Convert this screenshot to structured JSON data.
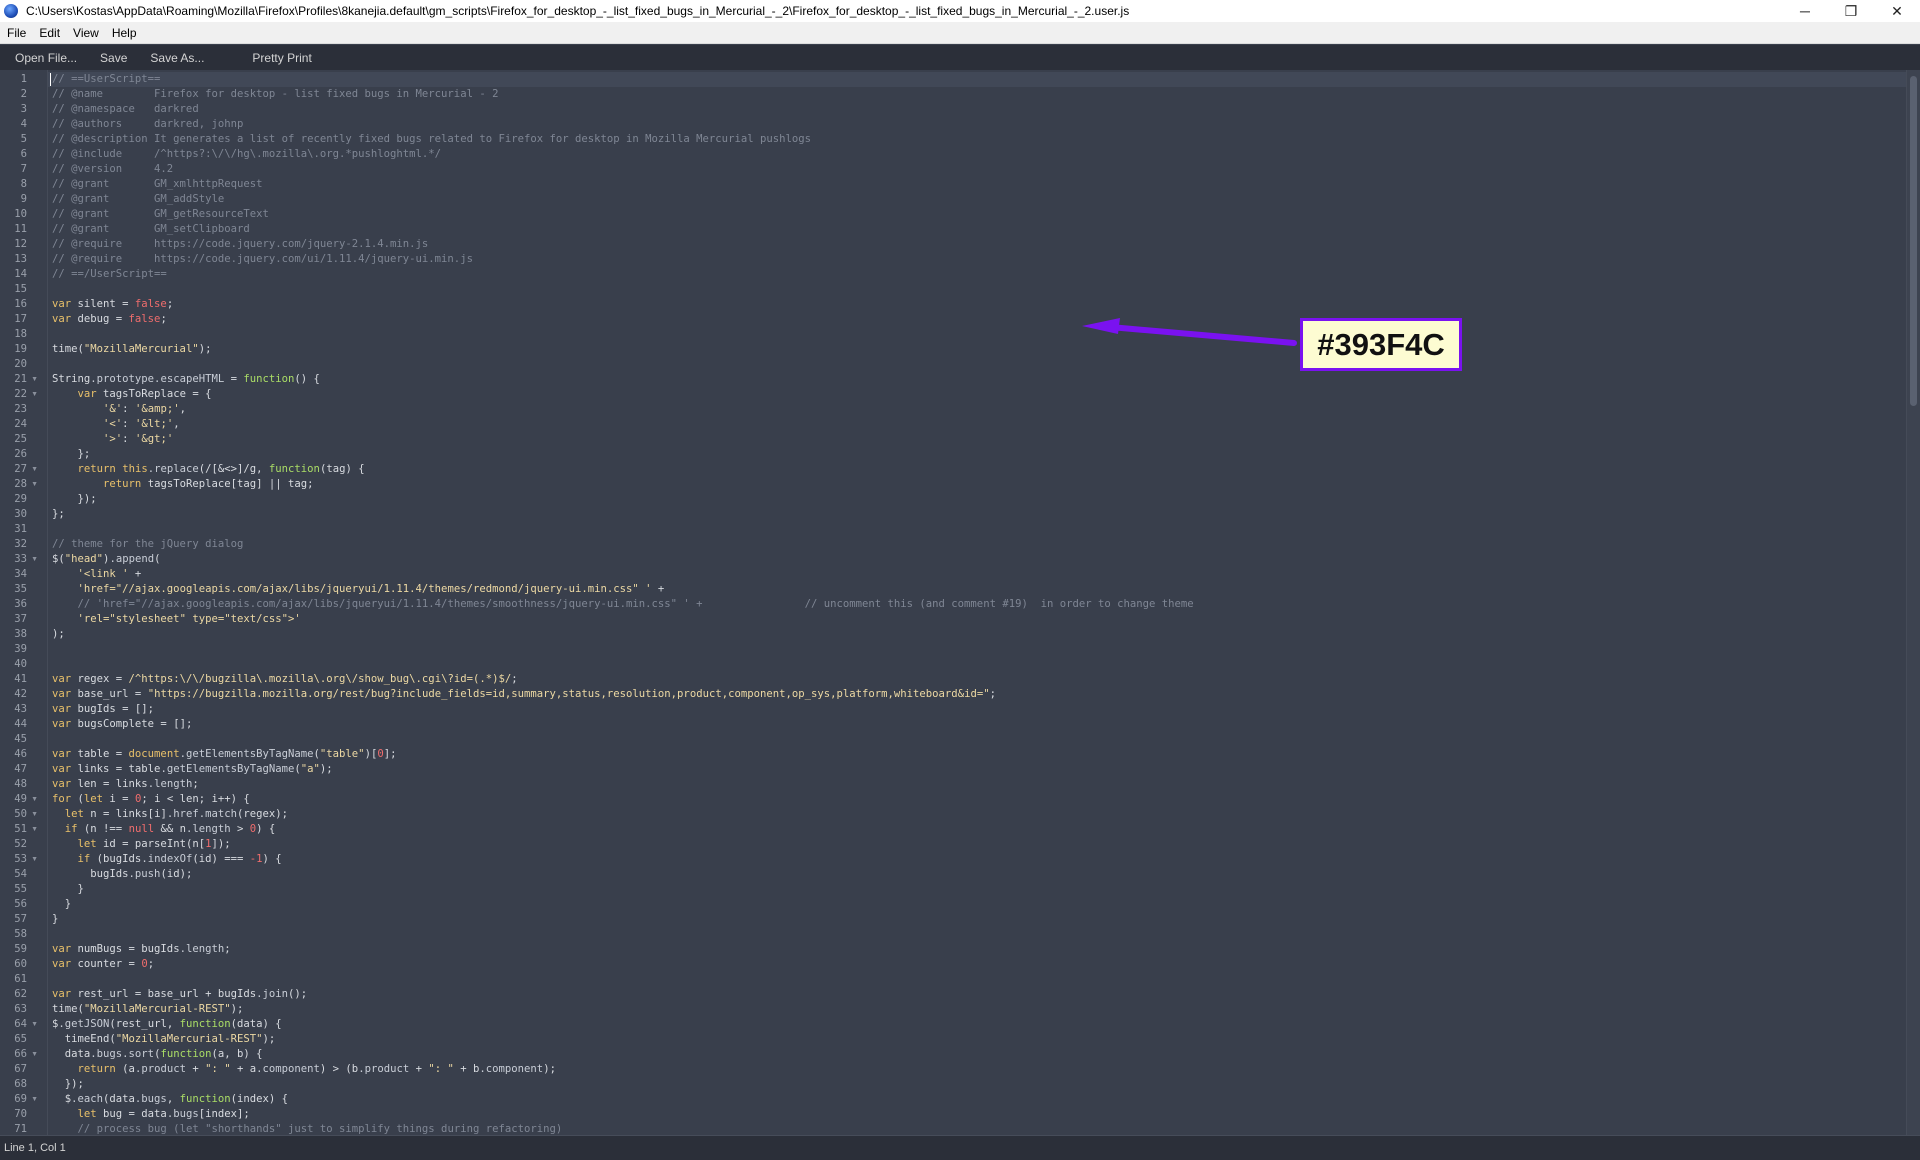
{
  "window": {
    "title": "C:\\Users\\Kostas\\AppData\\Roaming\\Mozilla\\Firefox\\Profiles\\8kanejia.default\\gm_scripts\\Firefox_for_desktop_-_list_fixed_bugs_in_Mercurial_-_2\\Firefox_for_desktop_-_list_fixed_bugs_in_Mercurial_-_2.user.js",
    "app_icon": "firefox-globe-icon",
    "minimize_glyph": "─",
    "maximize_glyph": "❐",
    "close_glyph": "✕"
  },
  "menubar": {
    "items": [
      "File",
      "Edit",
      "View",
      "Help"
    ]
  },
  "toolbar": {
    "open_file": "Open File...",
    "save": "Save",
    "save_as": "Save As...",
    "pretty_print": "Pretty Print"
  },
  "editor": {
    "background_color": "#393F4C",
    "current_line": 1,
    "fold_markers": [
      21,
      22,
      27,
      28,
      33,
      49,
      50,
      51,
      53,
      64,
      66,
      69
    ],
    "lines": [
      [
        [
          "com",
          "// ==UserScript=="
        ]
      ],
      [
        [
          "com",
          "// @name        Firefox for desktop - list fixed bugs in Mercurial - 2"
        ]
      ],
      [
        [
          "com",
          "// @namespace   darkred"
        ]
      ],
      [
        [
          "com",
          "// @authors     darkred, johnp"
        ]
      ],
      [
        [
          "com",
          "// @description It generates a list of recently fixed bugs related to Firefox for desktop in Mozilla Mercurial pushlogs"
        ]
      ],
      [
        [
          "com",
          "// @include     /^https?:\\/\\/hg\\.mozilla\\.org.*pushloghtml.*/"
        ]
      ],
      [
        [
          "com",
          "// @version     4.2"
        ]
      ],
      [
        [
          "com",
          "// @grant       GM_xmlhttpRequest"
        ]
      ],
      [
        [
          "com",
          "// @grant       GM_addStyle"
        ]
      ],
      [
        [
          "com",
          "// @grant       GM_getResourceText"
        ]
      ],
      [
        [
          "com",
          "// @grant       GM_setClipboard"
        ]
      ],
      [
        [
          "com",
          "// @require     https://code.jquery.com/jquery-2.1.4.min.js"
        ]
      ],
      [
        [
          "com",
          "// @require     https://code.jquery.com/ui/1.11.4/jquery-ui.min.js"
        ]
      ],
      [
        [
          "com",
          "// ==/UserScript=="
        ]
      ],
      [],
      [
        [
          "kw",
          "var"
        ],
        [
          "plain",
          " silent = "
        ],
        [
          "bool",
          "false"
        ],
        [
          "plain",
          ";"
        ]
      ],
      [
        [
          "kw",
          "var"
        ],
        [
          "plain",
          " debug = "
        ],
        [
          "bool",
          "false"
        ],
        [
          "plain",
          ";"
        ]
      ],
      [],
      [
        [
          "plain",
          "time("
        ],
        [
          "str",
          "\"MozillaMercurial\""
        ],
        [
          "plain",
          ");"
        ]
      ],
      [],
      [
        [
          "plain",
          "String"
        ],
        [
          "prop",
          ".prototype.escapeHTML"
        ],
        [
          "plain",
          " = "
        ],
        [
          "fn",
          "function"
        ],
        [
          "plain",
          "() {"
        ]
      ],
      [
        [
          "plain",
          "    "
        ],
        [
          "kw",
          "var"
        ],
        [
          "plain",
          " tagsToReplace = {"
        ]
      ],
      [
        [
          "plain",
          "        "
        ],
        [
          "str",
          "'&'"
        ],
        [
          "plain",
          ": "
        ],
        [
          "str",
          "'&amp;'"
        ],
        [
          "plain",
          ","
        ]
      ],
      [
        [
          "plain",
          "        "
        ],
        [
          "str",
          "'<'"
        ],
        [
          "plain",
          ": "
        ],
        [
          "str",
          "'&lt;'"
        ],
        [
          "plain",
          ","
        ]
      ],
      [
        [
          "plain",
          "        "
        ],
        [
          "str",
          "'>'"
        ],
        [
          "plain",
          ": "
        ],
        [
          "str",
          "'&gt;'"
        ]
      ],
      [
        [
          "plain",
          "    };"
        ]
      ],
      [
        [
          "plain",
          "    "
        ],
        [
          "kw",
          "return"
        ],
        [
          "plain",
          " "
        ],
        [
          "kw",
          "this"
        ],
        [
          "prop",
          ".replace"
        ],
        [
          "plain",
          "(/[&<>]/g, "
        ],
        [
          "fn",
          "function"
        ],
        [
          "plain",
          "(tag) {"
        ]
      ],
      [
        [
          "plain",
          "        "
        ],
        [
          "kw",
          "return"
        ],
        [
          "plain",
          " tagsToReplace[tag] || tag;"
        ]
      ],
      [
        [
          "plain",
          "    });"
        ]
      ],
      [
        [
          "plain",
          "};"
        ]
      ],
      [],
      [
        [
          "com",
          "// theme for the jQuery dialog"
        ]
      ],
      [
        [
          "plain",
          "$("
        ],
        [
          "str",
          "\"head\""
        ],
        [
          "plain",
          ")"
        ],
        [
          "prop",
          ".append"
        ],
        [
          "plain",
          "("
        ]
      ],
      [
        [
          "plain",
          "    "
        ],
        [
          "str",
          "'<link '"
        ],
        [
          "plain",
          " +"
        ]
      ],
      [
        [
          "plain",
          "    "
        ],
        [
          "str",
          "'href=\"//ajax.googleapis.com/ajax/libs/jqueryui/1.11.4/themes/redmond/jquery-ui.min.css\" '"
        ],
        [
          "plain",
          " +"
        ]
      ],
      [
        [
          "plain",
          "    "
        ],
        [
          "com",
          "// 'href=\"//ajax.googleapis.com/ajax/libs/jqueryui/1.11.4/themes/smoothness/jquery-ui.min.css\" ' +                // uncomment this (and comment #19)  in order to change theme"
        ]
      ],
      [
        [
          "plain",
          "    "
        ],
        [
          "str",
          "'rel=\"stylesheet\" type=\"text/css\">'"
        ]
      ],
      [
        [
          "plain",
          ");"
        ]
      ],
      [],
      [],
      [
        [
          "kw",
          "var"
        ],
        [
          "plain",
          " regex = "
        ],
        [
          "str",
          "/^https:\\/\\/bugzilla\\.mozilla\\.org\\/show_bug\\.cgi\\?id=(.*)$/"
        ],
        [
          "plain",
          ";"
        ]
      ],
      [
        [
          "kw",
          "var"
        ],
        [
          "plain",
          " base_url = "
        ],
        [
          "str",
          "\"https://bugzilla.mozilla.org/rest/bug?include_fields=id,summary,status,resolution,product,component,op_sys,platform,whiteboard&id=\""
        ],
        [
          "plain",
          ";"
        ]
      ],
      [
        [
          "kw",
          "var"
        ],
        [
          "plain",
          " bugIds = [];"
        ]
      ],
      [
        [
          "kw",
          "var"
        ],
        [
          "plain",
          " bugsComplete = [];"
        ]
      ],
      [],
      [
        [
          "kw",
          "var"
        ],
        [
          "plain",
          " table = "
        ],
        [
          "kw",
          "document"
        ],
        [
          "prop",
          ".getElementsByTagName"
        ],
        [
          "plain",
          "("
        ],
        [
          "str",
          "\"table\""
        ],
        [
          "plain",
          ")["
        ],
        [
          "num",
          "0"
        ],
        [
          "plain",
          "];"
        ]
      ],
      [
        [
          "kw",
          "var"
        ],
        [
          "plain",
          " links = table"
        ],
        [
          "prop",
          ".getElementsByTagName"
        ],
        [
          "plain",
          "("
        ],
        [
          "str",
          "\"a\""
        ],
        [
          "plain",
          ");"
        ]
      ],
      [
        [
          "kw",
          "var"
        ],
        [
          "plain",
          " len = links"
        ],
        [
          "prop",
          ".length"
        ],
        [
          "plain",
          ";"
        ]
      ],
      [
        [
          "kw",
          "for"
        ],
        [
          "plain",
          " ("
        ],
        [
          "kw",
          "let"
        ],
        [
          "plain",
          " i = "
        ],
        [
          "num",
          "0"
        ],
        [
          "plain",
          "; i < len; i++) {"
        ]
      ],
      [
        [
          "plain",
          "  "
        ],
        [
          "kw",
          "let"
        ],
        [
          "plain",
          " n = links[i]"
        ],
        [
          "prop",
          ".href.match"
        ],
        [
          "plain",
          "(regex);"
        ]
      ],
      [
        [
          "plain",
          "  "
        ],
        [
          "kw",
          "if"
        ],
        [
          "plain",
          " (n !== "
        ],
        [
          "bool",
          "null"
        ],
        [
          "plain",
          " && n"
        ],
        [
          "prop",
          ".length"
        ],
        [
          "plain",
          " > "
        ],
        [
          "num",
          "0"
        ],
        [
          "plain",
          ") {"
        ]
      ],
      [
        [
          "plain",
          "    "
        ],
        [
          "kw",
          "let"
        ],
        [
          "plain",
          " id = parseInt(n["
        ],
        [
          "num",
          "1"
        ],
        [
          "plain",
          "]);"
        ]
      ],
      [
        [
          "plain",
          "    "
        ],
        [
          "kw",
          "if"
        ],
        [
          "plain",
          " (bugIds"
        ],
        [
          "prop",
          ".indexOf"
        ],
        [
          "plain",
          "(id) === "
        ],
        [
          "num",
          "-1"
        ],
        [
          "plain",
          ") {"
        ]
      ],
      [
        [
          "plain",
          "      bugIds"
        ],
        [
          "prop",
          ".push"
        ],
        [
          "plain",
          "(id);"
        ]
      ],
      [
        [
          "plain",
          "    }"
        ]
      ],
      [
        [
          "plain",
          "  }"
        ]
      ],
      [
        [
          "plain",
          "}"
        ]
      ],
      [],
      [
        [
          "kw",
          "var"
        ],
        [
          "plain",
          " numBugs = bugIds"
        ],
        [
          "prop",
          ".length"
        ],
        [
          "plain",
          ";"
        ]
      ],
      [
        [
          "kw",
          "var"
        ],
        [
          "plain",
          " counter = "
        ],
        [
          "num",
          "0"
        ],
        [
          "plain",
          ";"
        ]
      ],
      [],
      [
        [
          "kw",
          "var"
        ],
        [
          "plain",
          " rest_url = base_url + bugIds"
        ],
        [
          "prop",
          ".join"
        ],
        [
          "plain",
          "();"
        ]
      ],
      [
        [
          "plain",
          "time("
        ],
        [
          "str",
          "\"MozillaMercurial-REST\""
        ],
        [
          "plain",
          ");"
        ]
      ],
      [
        [
          "plain",
          "$"
        ],
        [
          "prop",
          ".getJSON"
        ],
        [
          "plain",
          "(rest_url, "
        ],
        [
          "fn",
          "function"
        ],
        [
          "plain",
          "(data) {"
        ]
      ],
      [
        [
          "plain",
          "  timeEnd("
        ],
        [
          "str",
          "\"MozillaMercurial-REST\""
        ],
        [
          "plain",
          ");"
        ]
      ],
      [
        [
          "plain",
          "  data"
        ],
        [
          "prop",
          ".bugs.sort"
        ],
        [
          "plain",
          "("
        ],
        [
          "fn",
          "function"
        ],
        [
          "plain",
          "(a, b) {"
        ]
      ],
      [
        [
          "plain",
          "    "
        ],
        [
          "kw",
          "return"
        ],
        [
          "plain",
          " (a"
        ],
        [
          "prop",
          ".product"
        ],
        [
          "plain",
          " + "
        ],
        [
          "str",
          "\": \""
        ],
        [
          "plain",
          " + a"
        ],
        [
          "prop",
          ".component"
        ],
        [
          "plain",
          ") > (b"
        ],
        [
          "prop",
          ".product"
        ],
        [
          "plain",
          " + "
        ],
        [
          "str",
          "\": \""
        ],
        [
          "plain",
          " + b"
        ],
        [
          "prop",
          ".component"
        ],
        [
          "plain",
          ");"
        ]
      ],
      [
        [
          "plain",
          "  });"
        ]
      ],
      [
        [
          "plain",
          "  $"
        ],
        [
          "prop",
          ".each"
        ],
        [
          "plain",
          "(data"
        ],
        [
          "prop",
          ".bugs"
        ],
        [
          "plain",
          ", "
        ],
        [
          "fn",
          "function"
        ],
        [
          "plain",
          "(index) {"
        ]
      ],
      [
        [
          "plain",
          "    "
        ],
        [
          "kw",
          "let"
        ],
        [
          "plain",
          " bug = data"
        ],
        [
          "prop",
          ".bugs"
        ],
        [
          "plain",
          "[index];"
        ]
      ],
      [
        [
          "plain",
          "    "
        ],
        [
          "com",
          "// process bug (let \"shorthands\" just to simplify things during refactoring)"
        ]
      ]
    ]
  },
  "statusbar": {
    "text": "Line 1, Col 1"
  },
  "annotation": {
    "label": "#393F4C",
    "arrow_color": "#7a12f0",
    "label_background": "#fdfcd2"
  }
}
